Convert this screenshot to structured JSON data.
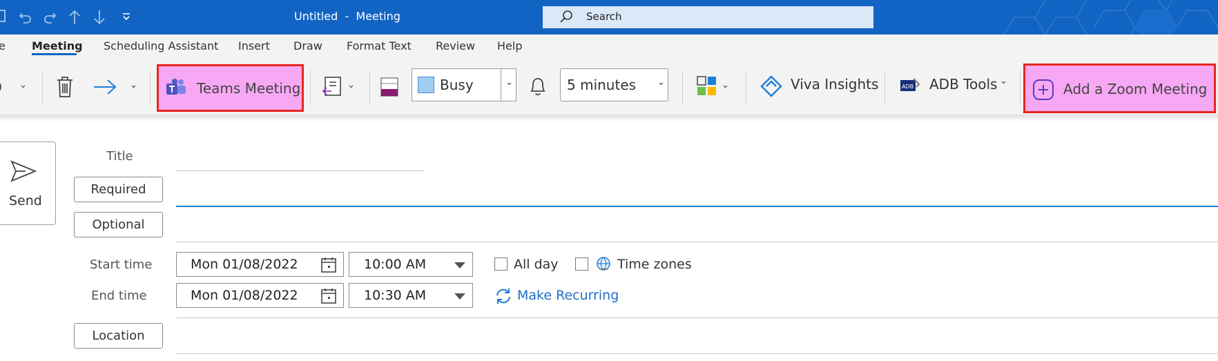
{
  "window": {
    "title": "Untitled  -  Meeting",
    "search_placeholder": "Search"
  },
  "tabs": [
    {
      "label": "e"
    },
    {
      "label": "Meeting",
      "active": true
    },
    {
      "label": "Scheduling Assistant"
    },
    {
      "label": "Insert"
    },
    {
      "label": "Draw"
    },
    {
      "label": "Format Text"
    },
    {
      "label": "Review"
    },
    {
      "label": "Help"
    }
  ],
  "ribbon": {
    "teams_meeting_label": "Teams Meeting",
    "show_as_value": "Busy",
    "reminder_value": "5 minutes",
    "viva_insights_label": "Viva Insights",
    "adb_tools_label": "ADB Tools",
    "zoom_label": "Add a Zoom Meeting",
    "highlight_color": "#e8251c",
    "highlight_fill": "#f7a8f4",
    "accent_color": "#1264c4"
  },
  "form": {
    "send_label": "Send",
    "title_label": "Title",
    "required_label": "Required",
    "optional_label": "Optional",
    "start_time_label": "Start time",
    "end_time_label": "End time",
    "start_date": "Mon 01/08/2022",
    "start_time": "10:00 AM",
    "end_date": "Mon 01/08/2022",
    "end_time": "10:30 AM",
    "all_day_label": "All day",
    "time_zones_label": "Time zones",
    "make_recurring_label": "Make Recurring",
    "location_label": "Location"
  }
}
